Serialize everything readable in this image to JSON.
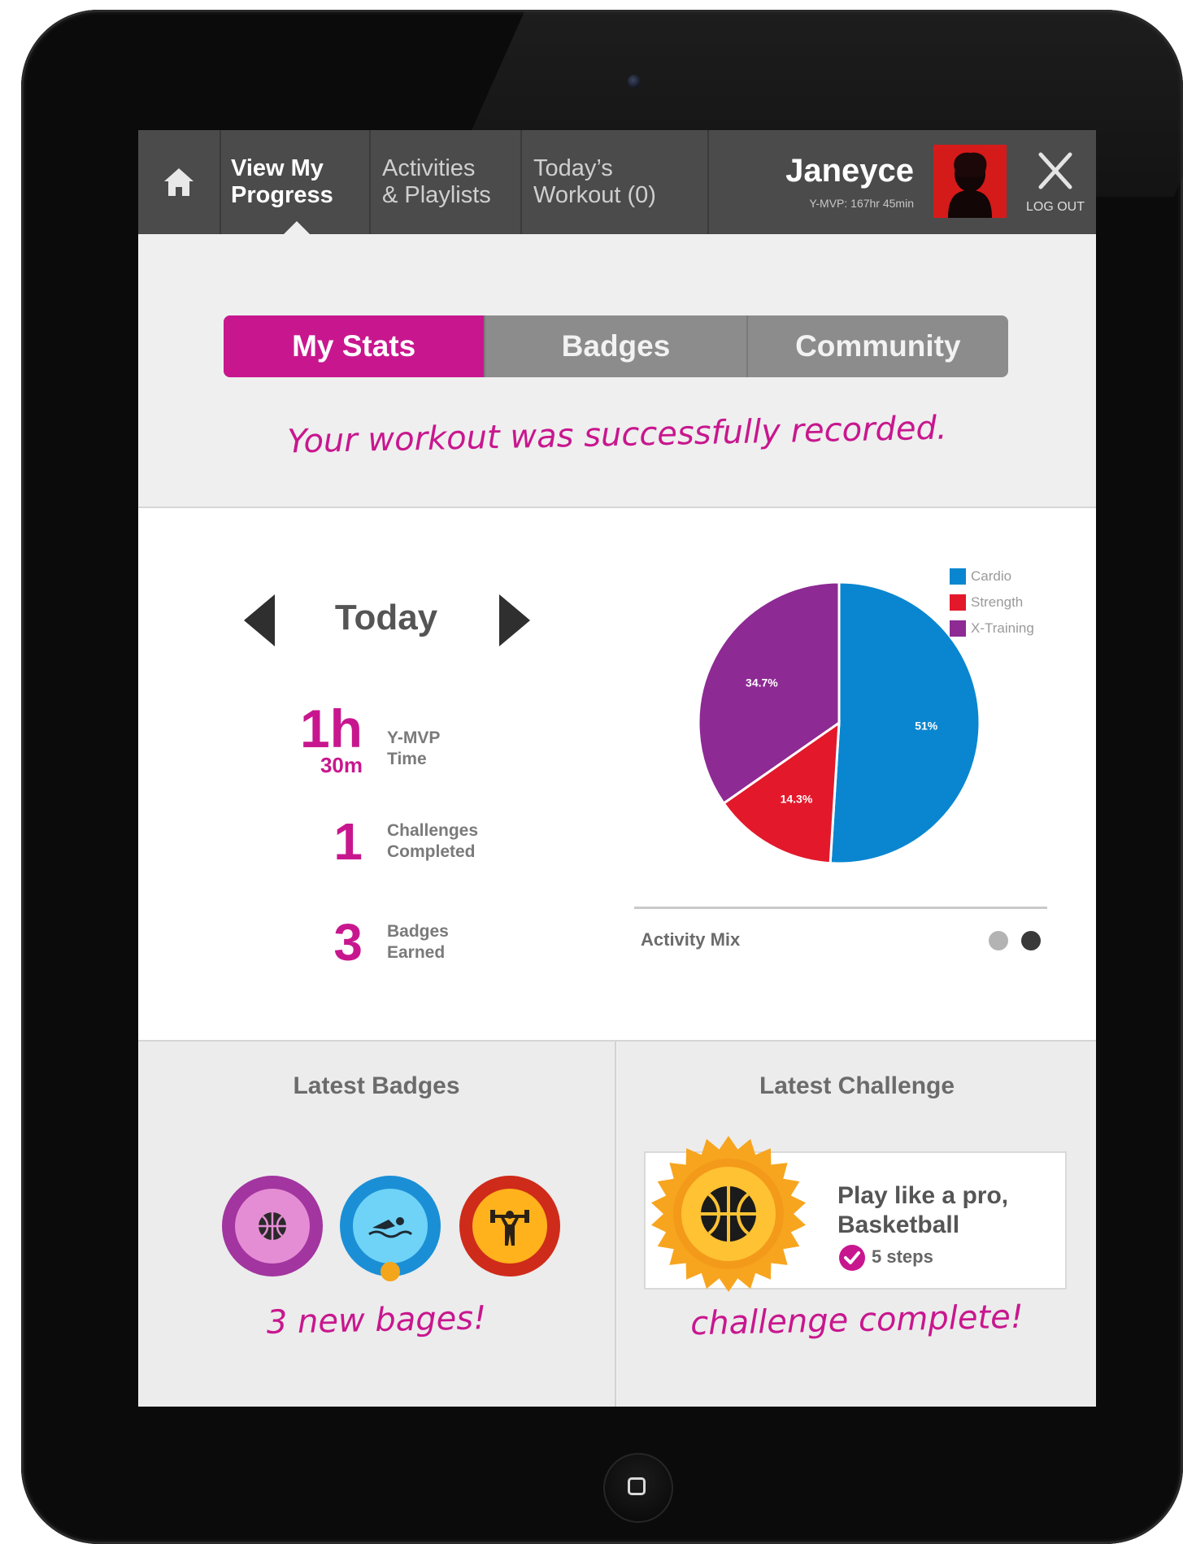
{
  "nav": {
    "items": [
      {
        "label": "View My\nProgress",
        "active": true
      },
      {
        "label": "Activities\n& Playlists",
        "active": false
      },
      {
        "label": "Today’s\nWorkout (0)",
        "active": false
      }
    ],
    "user": {
      "name": "Janeyce",
      "subtitle": "Y-MVP: 167hr 45min"
    },
    "logout_label": "LOG OUT"
  },
  "tabs": [
    {
      "label": "My Stats",
      "active": true
    },
    {
      "label": "Badges",
      "active": false
    },
    {
      "label": "Community",
      "active": false
    }
  ],
  "success_message": "Your workout was successfully recorded.",
  "stats": {
    "period": "Today",
    "time": {
      "hours": "1h",
      "minutes": "30m",
      "label": "Y-MVP\nTime"
    },
    "challenges": {
      "value": "1",
      "label": "Challenges\nCompleted"
    },
    "badges": {
      "value": "3",
      "label": "Badges\nEarned"
    }
  },
  "chart_data": {
    "type": "pie",
    "title": "Activity Mix",
    "series": [
      {
        "name": "Cardio",
        "value": 51,
        "label": "51%",
        "color": "#0a86d0"
      },
      {
        "name": "Strength",
        "value": 14.3,
        "label": "14.3%",
        "color": "#e3182b"
      },
      {
        "name": "X-Training",
        "value": 34.7,
        "label": "34.7%",
        "color": "#8d2a94"
      }
    ],
    "legend_position": "top-right",
    "page_indicator": {
      "pages": 2,
      "current": 2
    }
  },
  "latest_badges": {
    "title": "Latest Badges",
    "badges": [
      {
        "icon": "basketball-icon",
        "ring": "#a2359f",
        "inner": "#e58dd4"
      },
      {
        "icon": "swimmer-icon",
        "ring": "#1b8fd6",
        "inner": "#6fd3f7"
      },
      {
        "icon": "weightlifter-icon",
        "ring": "#cf2b1a",
        "inner": "#ffb21c"
      }
    ],
    "footer": "3 new bages!"
  },
  "latest_challenge": {
    "title": "Latest Challenge",
    "name": "Play like a pro,\nBasketball",
    "steps": "5 steps",
    "footer": "challenge complete!"
  },
  "colors": {
    "accent": "#c8178e",
    "nav_bg": "#4b4b4b"
  }
}
